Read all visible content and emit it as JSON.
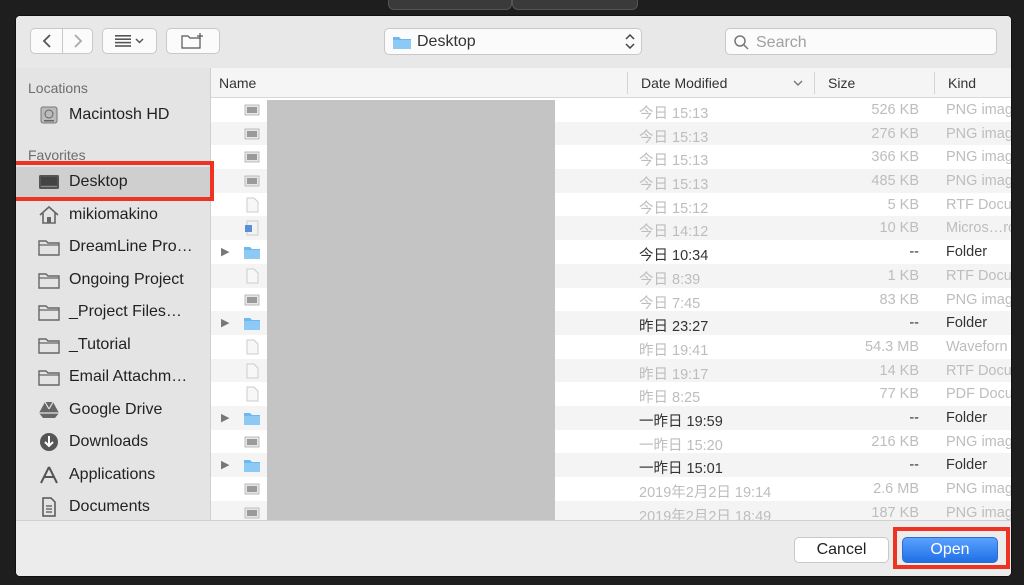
{
  "toolbar": {
    "back_icon": "chevron-left-icon",
    "forward_icon": "chevron-right-icon",
    "view_icon": "list-view-icon",
    "new_folder_icon": "new-folder-icon",
    "location": "Desktop",
    "search_placeholder": "Search"
  },
  "sidebar": {
    "locations_header": "Locations",
    "locations": [
      {
        "label": "Macintosh HD",
        "icon": "harddisk-icon"
      }
    ],
    "favorites_header": "Favorites",
    "favorites": [
      {
        "label": "Desktop",
        "icon": "desktop-icon",
        "selected": true
      },
      {
        "label": "mikiomakino",
        "icon": "home-icon"
      },
      {
        "label": "DreamLine Pro…",
        "icon": "folder-icon"
      },
      {
        "label": "Ongoing Project",
        "icon": "folder-icon"
      },
      {
        "label": "_Project Files…",
        "icon": "folder-icon"
      },
      {
        "label": "_Tutorial",
        "icon": "folder-icon"
      },
      {
        "label": "Email Attachm…",
        "icon": "folder-icon"
      },
      {
        "label": "Google Drive",
        "icon": "google-drive-icon"
      },
      {
        "label": "Downloads",
        "icon": "downloads-icon"
      },
      {
        "label": "Applications",
        "icon": "applications-icon"
      },
      {
        "label": "Documents",
        "icon": "documents-icon"
      }
    ]
  },
  "columns": {
    "name": "Name",
    "date_modified": "Date Modified",
    "size": "Size",
    "kind": "Kind"
  },
  "files": [
    {
      "date": "今日 15:13",
      "size": "526 KB",
      "kind": "PNG imag",
      "type": "png",
      "enabled": false
    },
    {
      "date": "今日 15:13",
      "size": "276 KB",
      "kind": "PNG imag",
      "type": "png",
      "enabled": false
    },
    {
      "date": "今日 15:13",
      "size": "366 KB",
      "kind": "PNG imag",
      "type": "png",
      "enabled": false
    },
    {
      "date": "今日 15:13",
      "size": "485 KB",
      "kind": "PNG imag",
      "type": "png",
      "enabled": false
    },
    {
      "date": "今日 15:12",
      "size": "5 KB",
      "kind": "RTF Docu",
      "type": "doc",
      "enabled": false
    },
    {
      "date": "今日 14:12",
      "size": "10 KB",
      "kind": "Micros…ro",
      "type": "word",
      "enabled": false
    },
    {
      "date": "今日 10:34",
      "size": "--",
      "kind": "Folder",
      "type": "folder",
      "enabled": true
    },
    {
      "date": "今日 8:39",
      "size": "1 KB",
      "kind": "RTF Docu",
      "type": "doc",
      "enabled": false
    },
    {
      "date": "今日 7:45",
      "size": "83 KB",
      "kind": "PNG imag",
      "type": "png",
      "enabled": false
    },
    {
      "date": "昨日 23:27",
      "size": "--",
      "kind": "Folder",
      "type": "folder",
      "enabled": true
    },
    {
      "date": "昨日 19:41",
      "size": "54.3 MB",
      "kind": "Waveforn",
      "type": "doc",
      "enabled": false
    },
    {
      "date": "昨日 19:17",
      "size": "14 KB",
      "kind": "RTF Docu",
      "type": "doc",
      "enabled": false
    },
    {
      "date": "昨日 8:25",
      "size": "77 KB",
      "kind": "PDF Docu",
      "type": "doc",
      "enabled": false
    },
    {
      "date": "一昨日 19:59",
      "size": "--",
      "kind": "Folder",
      "type": "folder",
      "enabled": true
    },
    {
      "date": "一昨日 15:20",
      "size": "216 KB",
      "kind": "PNG imag",
      "type": "png",
      "enabled": false
    },
    {
      "date": "一昨日 15:01",
      "size": "--",
      "kind": "Folder",
      "type": "folder",
      "enabled": true
    },
    {
      "date": "2019年2月2日 19:14",
      "size": "2.6 MB",
      "kind": "PNG imag",
      "type": "png",
      "enabled": false
    },
    {
      "date": "2019年2月2日 18:49",
      "size": "187 KB",
      "kind": "PNG imag",
      "type": "png",
      "enabled": false
    }
  ],
  "buttons": {
    "cancel": "Cancel",
    "open": "Open"
  },
  "colors": {
    "highlight": "#ee3322",
    "accent": "#1f6fe6",
    "folder": "#6cb8f0"
  }
}
